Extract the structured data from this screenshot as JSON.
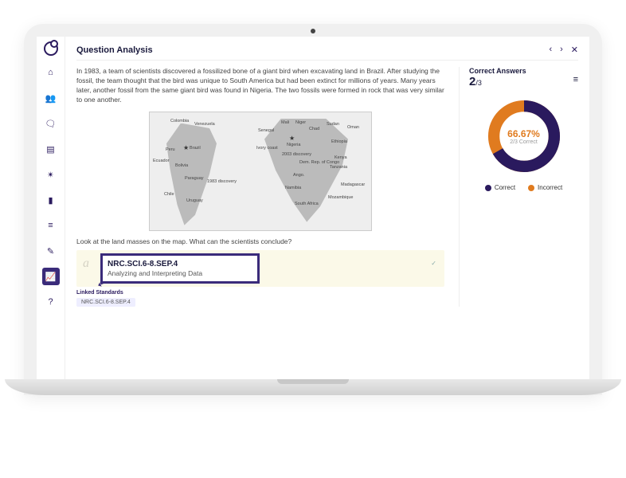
{
  "header": {
    "title": "Question Analysis"
  },
  "question": {
    "passage": "In 1983, a team of scientists discovered a fossilized bone of a giant bird when excavating land in Brazil. After studying the fossil, the team thought that the bird was unique to South America but had been extinct for millions of years. Many years later, another fossil from the same giant bird was found in Nigeria. The two fossils were formed in rock that was very similar to one another.",
    "prompt": "Look at the land masses on the map. What can the scientists conclude?"
  },
  "map_labels": {
    "colombia": "Colombia",
    "venezuela": "Venezuela",
    "peru": "Peru",
    "brazil": "Brazil",
    "ecuador": "Ecuador",
    "bolivia": "Bolivia",
    "paraguay": "Paraguay",
    "chile": "Chile",
    "uruguay": "Uruguay",
    "discovery1": "1983 discovery",
    "senegal": "Senegal",
    "ivory": "Ivory coast",
    "mali": "Mali",
    "niger": "Niger",
    "nigeria": "Nigeria",
    "chad": "Chad",
    "sudan": "Sudan",
    "oman": "Oman",
    "ethiopia": "Ethiopia",
    "drc": "Dem. Rep. of Congo",
    "kenya": "Kenya",
    "tanzania": "Tanzania",
    "namibia": "Namibia",
    "madagascar": "Madagascar",
    "southafrica": "South Africa",
    "mozambique": "Mozambique",
    "ango": "Ango.",
    "discovery2": "2003 discovery"
  },
  "answer": {
    "letter": "a",
    "standard_code": "NRC.SCI.6-8.SEP.4",
    "standard_desc": "Analyzing and Interpreting Data"
  },
  "linked": {
    "label": "Linked Standards",
    "tag": "NRC.SCI.6-8.SEP.4"
  },
  "correct_panel": {
    "title": "Correct Answers",
    "numerator": "2",
    "denominator": "/3",
    "pct": "66.67%",
    "sub": "2/3 Correct",
    "legend_correct": "Correct",
    "legend_incorrect": "Incorrect"
  },
  "chart_data": {
    "type": "pie",
    "title": "Correct Answers",
    "series": [
      {
        "name": "Correct",
        "value": 2,
        "color": "#2a1a5e",
        "pct": 66.67
      },
      {
        "name": "Incorrect",
        "value": 1,
        "color": "#e07b1f",
        "pct": 33.33
      }
    ],
    "total": 3
  }
}
